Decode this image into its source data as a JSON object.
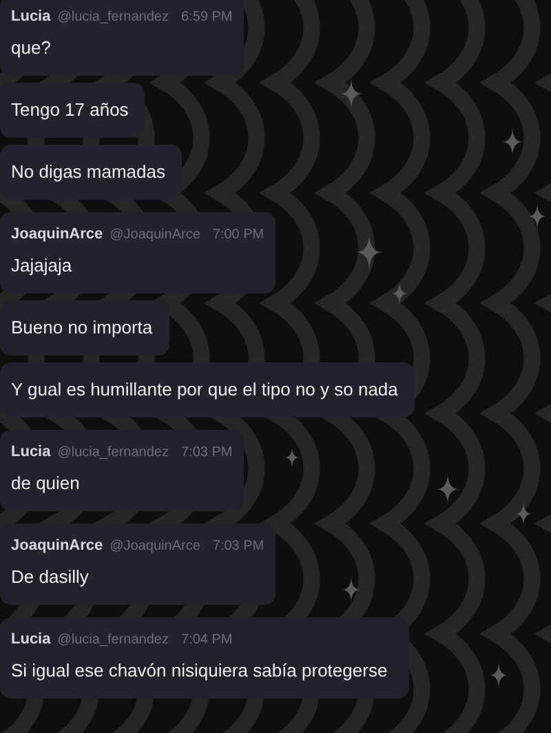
{
  "messages": [
    {
      "kind": "header",
      "author": "Lucia",
      "handle": "@lucia_fernandez",
      "time": "6:59 PM",
      "text": "que?"
    },
    {
      "kind": "plain",
      "text": "Tengo 17 años"
    },
    {
      "kind": "plain",
      "text": "No digas mamadas"
    },
    {
      "kind": "header",
      "author": "JoaquinArce",
      "handle": "@JoaquinArce",
      "time": "7:00 PM",
      "text": "Jajajaja"
    },
    {
      "kind": "plain",
      "text": "Bueno no importa"
    },
    {
      "kind": "plain",
      "text": "Y gual es humillante por que el tipo no y so nada"
    },
    {
      "kind": "header",
      "author": "Lucia",
      "handle": "@lucia_fernandez",
      "time": "7:03 PM",
      "text": "de quien"
    },
    {
      "kind": "header",
      "author": "JoaquinArce",
      "handle": "@JoaquinArce",
      "time": "7:03 PM",
      "text": "De dasilly"
    },
    {
      "kind": "header",
      "author": "Lucia",
      "handle": "@lucia_fernandez",
      "time": "7:04 PM",
      "text": "Si igual ese chavón nisiquiera sabía protegerse"
    }
  ]
}
